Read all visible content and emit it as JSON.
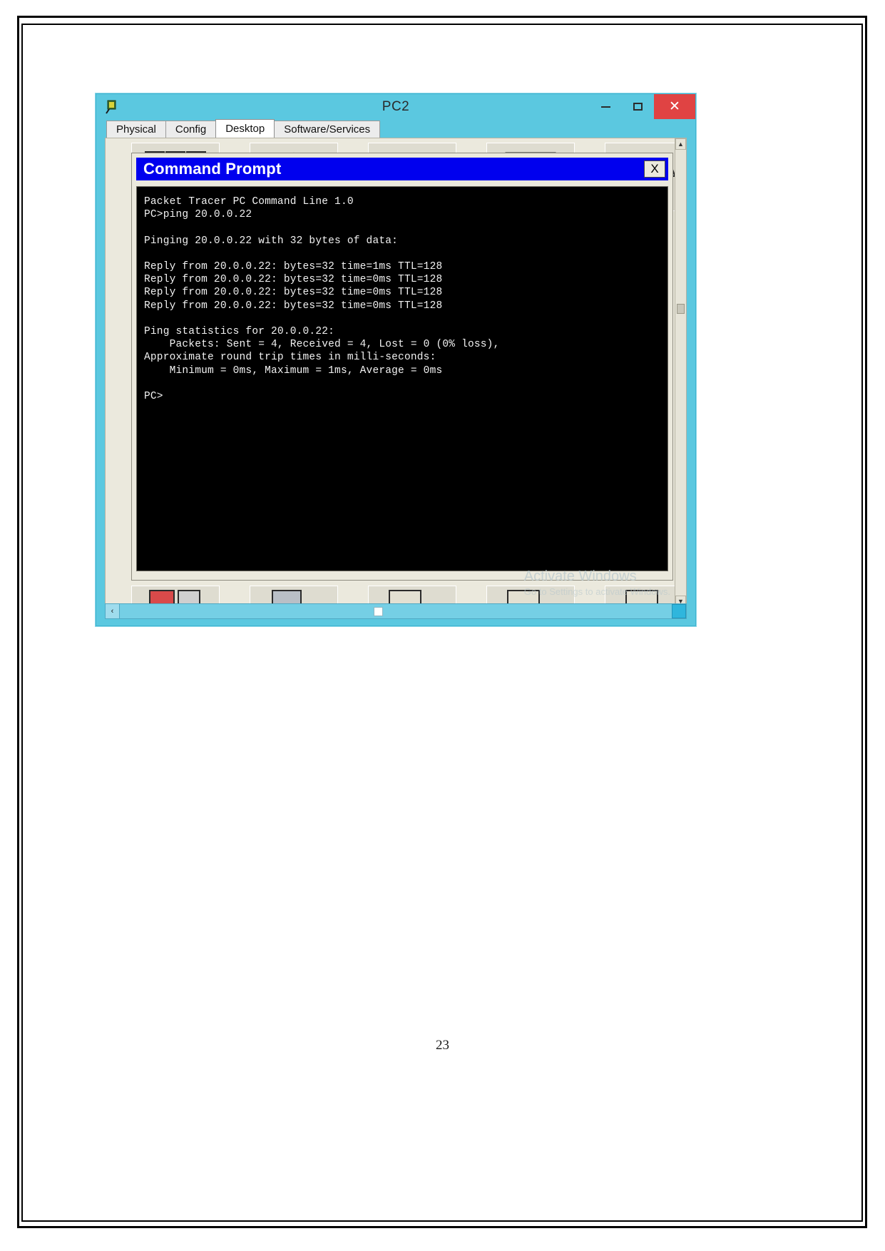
{
  "document": {
    "page_number": "23"
  },
  "app_window": {
    "title": "PC2",
    "icon": "packet-tracer-pc-icon",
    "controls": {
      "minimize": "–",
      "maximize": "□",
      "close": "✕"
    },
    "tabs": [
      {
        "label": "Physical",
        "active": false
      },
      {
        "label": "Config",
        "active": false
      },
      {
        "label": "Desktop",
        "active": true
      },
      {
        "label": "Software/Services",
        "active": false
      }
    ]
  },
  "desktop": {
    "icons": [
      "ip-configuration-icon",
      "dial-up-icon",
      "terminal-icon",
      "command-prompt-icon",
      "web-browser-icon"
    ],
    "icons_bottom": [
      "email-icon",
      "pc-wireless-icon",
      "vpn-icon",
      "traffic-generator-icon",
      "mib-browser-icon"
    ]
  },
  "command_prompt": {
    "title": "Command Prompt",
    "close_label": "X",
    "lines": [
      "Packet Tracer PC Command Line 1.0",
      "PC>ping 20.0.0.22",
      "",
      "Pinging 20.0.0.22 with 32 bytes of data:",
      "",
      "Reply from 20.0.0.22: bytes=32 time=1ms TTL=128",
      "Reply from 20.0.0.22: bytes=32 time=0ms TTL=128",
      "Reply from 20.0.0.22: bytes=32 time=0ms TTL=128",
      "Reply from 20.0.0.22: bytes=32 time=0ms TTL=128",
      "",
      "Ping statistics for 20.0.0.22:",
      "    Packets: Sent = 4, Received = 4, Lost = 0 (0% loss),",
      "Approximate round trip times in milli-seconds:",
      "    Minimum = 0ms, Maximum = 1ms, Average = 0ms",
      "",
      "PC>"
    ]
  },
  "scrollbars": {
    "vertical_up": "▲",
    "vertical_down": "▼",
    "horizontal_left": "‹",
    "horizontal_right": "›"
  },
  "watermark": {
    "title": "Activate Windows",
    "subtitle": "Go to Settings to activate Windows."
  },
  "colors": {
    "window_chrome": "#5bc8e0",
    "cmd_titlebar": "#0000ee",
    "terminal_bg": "#000000",
    "terminal_fg": "#f2f2f2",
    "close_button": "#e04343",
    "panel_bg": "#ebe9dd"
  }
}
